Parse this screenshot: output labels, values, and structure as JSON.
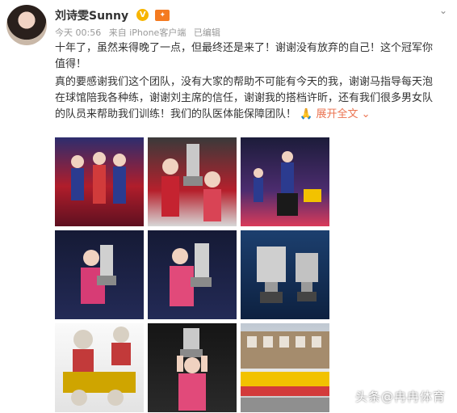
{
  "user": {
    "name": "刘诗雯Sunny",
    "vip_badge": "V",
    "crown_badge": "👑"
  },
  "meta": {
    "time": "今天 00:56",
    "source": "来自 iPhone客户端",
    "edited": "已编辑"
  },
  "post": {
    "paragraph1": "十年了，虽然来得晚了一点，但最终还是来了！谢谢没有放弃的自己！这个冠军你值得！",
    "paragraph2": "真的要感谢我们这个团队，没有大家的帮助不可能有今天的我，谢谢马指导每天泡在球馆陪我各种练，谢谢刘主席的信任，谢谢我的搭档许昕，还有我们很多男女队的队员来帮助我们训练！我们的队医体能保障团队！",
    "emoji": "🙏",
    "expand_label": "展开全文",
    "expand_icon": "chevron-down-icon"
  },
  "photos": [
    "team-celebration-photo",
    "trophy-duo-photo",
    "match-celebration-photo",
    "trophy-portrait-photo-1",
    "trophy-portrait-photo-2",
    "trophies-photo",
    "mascots-medals-photo",
    "trophy-raised-photo",
    "tram-street-photo"
  ],
  "watermark": {
    "text": "头条@冉冉体育"
  },
  "colors": {
    "link": "#eb7350",
    "meta": "#999999",
    "vip": "#f7b500"
  }
}
